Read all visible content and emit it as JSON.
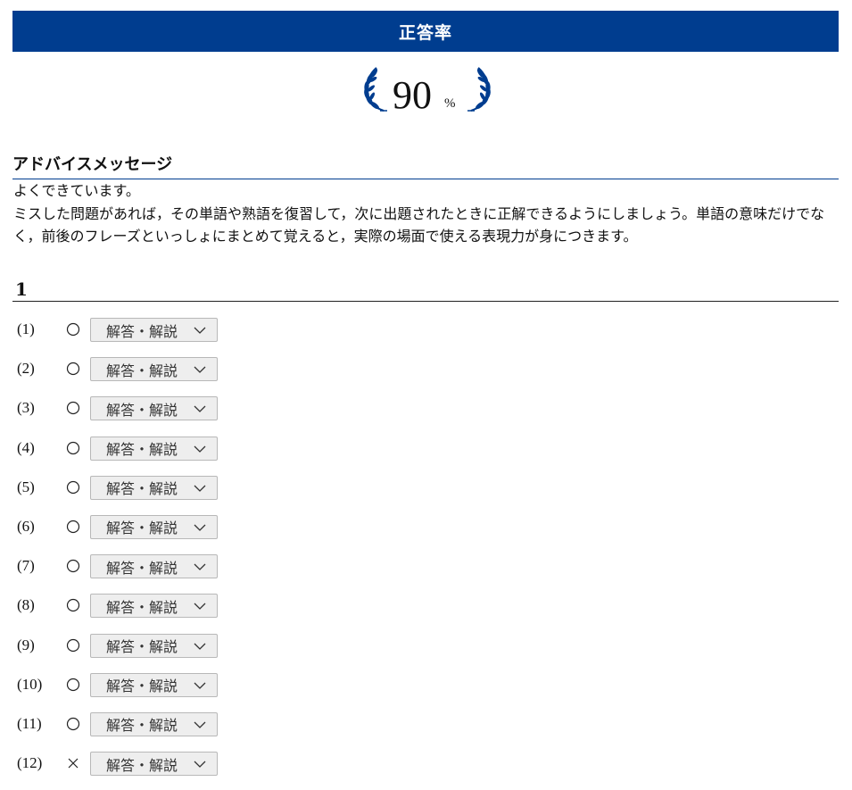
{
  "header": {
    "title": "正答率"
  },
  "score": {
    "value": "90",
    "unit": "%",
    "icon": "laurel-icon",
    "accent_color": "#003d8f"
  },
  "advice": {
    "title": "アドバイスメッセージ",
    "lines": [
      "よくできています。",
      "ミスした問題があれば，その単語や熟語を復習して，次に出題されたときに正解できるようにしましょう。単語の意味だけでなく，前後のフレーズといっしょにまとめて覚えると，実際の場面で使える表現力が身につきます。"
    ]
  },
  "section": {
    "title": "1"
  },
  "questions": [
    {
      "number": "(1)",
      "result": "correct",
      "button_label": "解答・解説"
    },
    {
      "number": "(2)",
      "result": "correct",
      "button_label": "解答・解説"
    },
    {
      "number": "(3)",
      "result": "correct",
      "button_label": "解答・解説"
    },
    {
      "number": "(4)",
      "result": "correct",
      "button_label": "解答・解説"
    },
    {
      "number": "(5)",
      "result": "correct",
      "button_label": "解答・解説"
    },
    {
      "number": "(6)",
      "result": "correct",
      "button_label": "解答・解説"
    },
    {
      "number": "(7)",
      "result": "correct",
      "button_label": "解答・解説"
    },
    {
      "number": "(8)",
      "result": "correct",
      "button_label": "解答・解説"
    },
    {
      "number": "(9)",
      "result": "correct",
      "button_label": "解答・解説"
    },
    {
      "number": "(10)",
      "result": "correct",
      "button_label": "解答・解説"
    },
    {
      "number": "(11)",
      "result": "correct",
      "button_label": "解答・解説"
    },
    {
      "number": "(12)",
      "result": "incorrect",
      "button_label": "解答・解説"
    }
  ],
  "icons": {
    "correct": "circle-mark-icon",
    "incorrect": "cross-mark-icon",
    "expand": "chevron-down-icon"
  }
}
